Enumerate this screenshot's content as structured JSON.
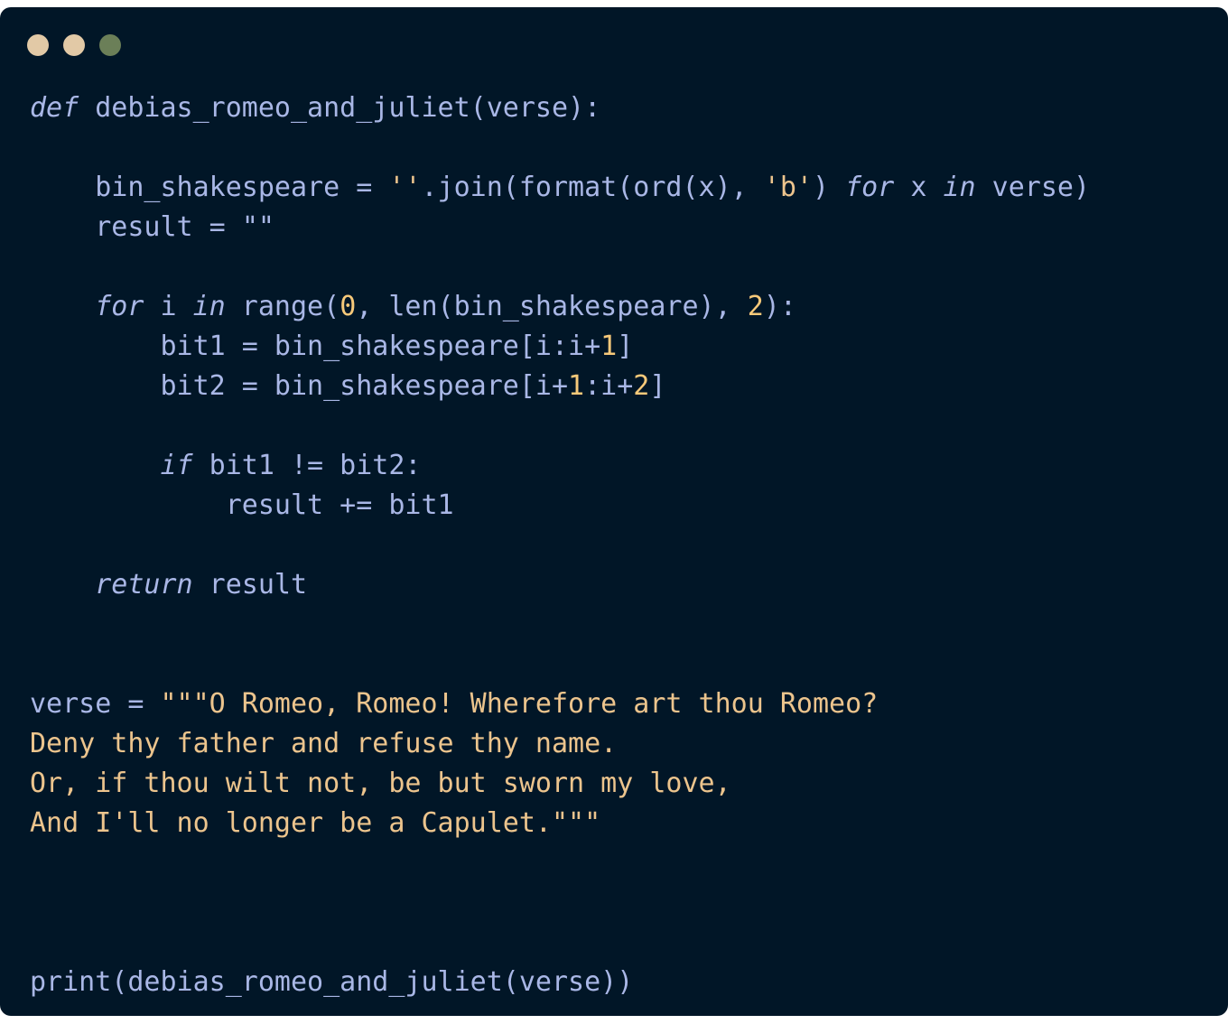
{
  "window": {
    "traffic_lights": [
      {
        "name": "close",
        "color": "#e2c9a6"
      },
      {
        "name": "minimize",
        "color": "#e2c9a6"
      },
      {
        "name": "maximize",
        "color": "#6b7f58"
      }
    ],
    "background": "#011627"
  },
  "colors": {
    "plain": "#a9b7e6",
    "keyword": "#a9b7e6",
    "string": "#ecc48d",
    "number": "#f7c97a"
  },
  "code": {
    "language": "python",
    "lines": [
      {
        "text": "",
        "tokens": [
          {
            "t": "def",
            "k": "kw"
          },
          {
            "t": " debias_romeo_and_juliet(verse):",
            "k": "plain"
          }
        ]
      },
      {
        "text": "",
        "tokens": []
      },
      {
        "text": "",
        "tokens": [
          {
            "t": "    bin_shakespeare = ",
            "k": "plain"
          },
          {
            "t": "''",
            "k": "str"
          },
          {
            "t": ".join(format(ord(x), ",
            "k": "plain"
          },
          {
            "t": "'b'",
            "k": "str"
          },
          {
            "t": ") ",
            "k": "plain"
          },
          {
            "t": "for",
            "k": "kw"
          },
          {
            "t": " x ",
            "k": "plain"
          },
          {
            "t": "in",
            "k": "kw"
          },
          {
            "t": " verse)",
            "k": "plain"
          }
        ]
      },
      {
        "text": "",
        "tokens": [
          {
            "t": "    result = ",
            "k": "plain"
          },
          {
            "t": "\"\"",
            "k": "plain"
          }
        ]
      },
      {
        "text": "",
        "tokens": []
      },
      {
        "text": "",
        "tokens": [
          {
            "t": "    ",
            "k": "plain"
          },
          {
            "t": "for",
            "k": "kw"
          },
          {
            "t": " i ",
            "k": "plain"
          },
          {
            "t": "in",
            "k": "kw"
          },
          {
            "t": " range(",
            "k": "plain"
          },
          {
            "t": "0",
            "k": "num"
          },
          {
            "t": ", len(bin_shakespeare), ",
            "k": "plain"
          },
          {
            "t": "2",
            "k": "num"
          },
          {
            "t": "):",
            "k": "plain"
          }
        ]
      },
      {
        "text": "",
        "tokens": [
          {
            "t": "        bit1 = bin_shakespeare[i:i+",
            "k": "plain"
          },
          {
            "t": "1",
            "k": "num"
          },
          {
            "t": "]",
            "k": "plain"
          }
        ]
      },
      {
        "text": "",
        "tokens": [
          {
            "t": "        bit2 = bin_shakespeare[i+",
            "k": "plain"
          },
          {
            "t": "1",
            "k": "num"
          },
          {
            "t": ":i+",
            "k": "plain"
          },
          {
            "t": "2",
            "k": "num"
          },
          {
            "t": "]",
            "k": "plain"
          }
        ]
      },
      {
        "text": "",
        "tokens": []
      },
      {
        "text": "",
        "tokens": [
          {
            "t": "        ",
            "k": "plain"
          },
          {
            "t": "if",
            "k": "kw"
          },
          {
            "t": " bit1 != bit2:",
            "k": "plain"
          }
        ]
      },
      {
        "text": "",
        "tokens": [
          {
            "t": "            result += bit1",
            "k": "plain"
          }
        ]
      },
      {
        "text": "",
        "tokens": []
      },
      {
        "text": "",
        "tokens": [
          {
            "t": "    ",
            "k": "plain"
          },
          {
            "t": "return",
            "k": "kw"
          },
          {
            "t": " result",
            "k": "plain"
          }
        ]
      },
      {
        "text": "",
        "tokens": []
      },
      {
        "text": "",
        "tokens": []
      },
      {
        "text": "",
        "tokens": [
          {
            "t": "verse = ",
            "k": "plain"
          },
          {
            "t": "\"\"\"O Romeo, Romeo! Wherefore art thou Romeo?",
            "k": "str"
          }
        ]
      },
      {
        "text": "",
        "tokens": [
          {
            "t": "Deny thy father and refuse thy name.",
            "k": "str"
          }
        ]
      },
      {
        "text": "",
        "tokens": [
          {
            "t": "Or, if thou wilt not, be but sworn my love,",
            "k": "str"
          }
        ]
      },
      {
        "text": "",
        "tokens": [
          {
            "t": "And I'll no longer be a Capulet.\"\"\"",
            "k": "str"
          }
        ]
      },
      {
        "text": "",
        "tokens": []
      },
      {
        "text": "",
        "tokens": []
      },
      {
        "text": "",
        "tokens": []
      },
      {
        "text": "",
        "tokens": [
          {
            "t": "print(debias_romeo_and_juliet(verse))",
            "k": "plain"
          }
        ]
      }
    ]
  }
}
